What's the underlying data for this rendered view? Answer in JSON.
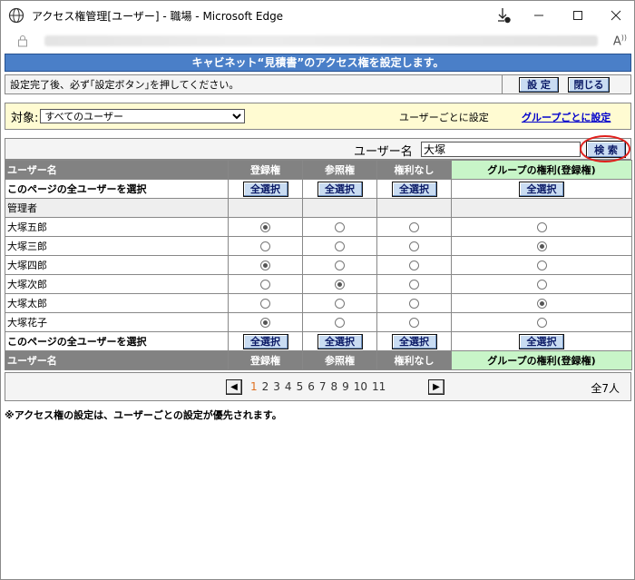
{
  "window": {
    "title": "アクセス権管理[ユーザー] - 職場 - Microsoft Edge"
  },
  "banner": "キャビネット“見積書”のアクセス権を設定します。",
  "instruction": {
    "text": "設定完了後、必ず｢設定ボタン｣を押してください。",
    "set_label": "設 定",
    "close_label": "閉じる"
  },
  "target": {
    "label": "対象:",
    "selected": "すべてのユーザー",
    "per_user": "ユーザーごとに設定",
    "per_group": "グループごとに設定"
  },
  "search": {
    "label": "ユーザー名",
    "value": "大塚",
    "button": "検 索"
  },
  "table": {
    "headers": [
      "ユーザー名",
      "登録権",
      "参照権",
      "権利なし",
      "グループの権利(登録権)"
    ],
    "select_all_label": "このページの全ユーザーを選択",
    "select_all_button": "全選択",
    "group_name": "管理者",
    "rows": [
      {
        "name": "大塚五郎",
        "choice": 0
      },
      {
        "name": "大塚三郎",
        "choice": 3
      },
      {
        "name": "大塚四郎",
        "choice": 0
      },
      {
        "name": "大塚次郎",
        "choice": 1
      },
      {
        "name": "大塚太郎",
        "choice": 3
      },
      {
        "name": "大塚花子",
        "choice": 0
      }
    ]
  },
  "pager": {
    "pages": [
      "1",
      "2",
      "3",
      "4",
      "5",
      "6",
      "7",
      "8",
      "9",
      "10",
      "11"
    ],
    "current": "1",
    "total": "全7人"
  },
  "note": "※アクセス権の設定は、ユーザーごとの設定が優先されます。"
}
